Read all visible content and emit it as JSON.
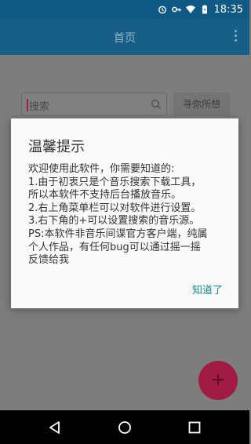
{
  "status_bar": {
    "time": "18:35"
  },
  "app_bar": {
    "title": "首页"
  },
  "search": {
    "placeholder": "搜索",
    "button_label": "寻你所想"
  },
  "fab": {
    "label": "+"
  },
  "dialog": {
    "title": "温馨提示",
    "lines": [
      "欢迎使用此软件，你需要知道的:",
      "1.由于初衷只是个音乐搜索下载工具，",
      "所以本软件不支持后台播放音乐。",
      "2.右上角菜单栏可以对软件进行设置。",
      "3.右下角的+可以设置搜索的音乐源。",
      "PS:本软件非音乐间谍官方客户端，纯属",
      "个人作品，有任何bug可以通过摇一摇",
      "反馈给我"
    ],
    "confirm_label": "知道了"
  },
  "colors": {
    "accent": "#148f8a",
    "app_bar": "#175f86",
    "fab": "#c2185b"
  },
  "icons": [
    "alarm-icon",
    "key-icon",
    "wifi-icon",
    "battery-icon",
    "more-vert-icon",
    "search-icon",
    "back-icon",
    "home-icon",
    "recents-icon"
  ]
}
